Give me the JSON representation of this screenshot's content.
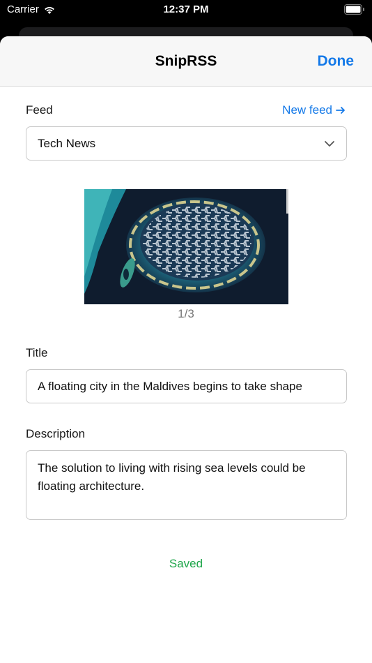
{
  "status_bar": {
    "carrier": "Carrier",
    "time": "12:37 PM"
  },
  "nav": {
    "title": "SnipRSS",
    "done_label": "Done"
  },
  "feed": {
    "label": "Feed",
    "new_feed_link": "New feed",
    "new_feed_icon": "arrow-right-icon",
    "selected": "Tech News"
  },
  "image": {
    "pager": "1/3"
  },
  "title_field": {
    "label": "Title",
    "value": "A floating city in the Maldives begins to take shape"
  },
  "description_field": {
    "label": "Description",
    "value": "The solution to living with rising sea levels could be floating architecture."
  },
  "status": {
    "saved": "Saved"
  },
  "colors": {
    "accent": "#1479e8",
    "success": "#1ea64a"
  }
}
